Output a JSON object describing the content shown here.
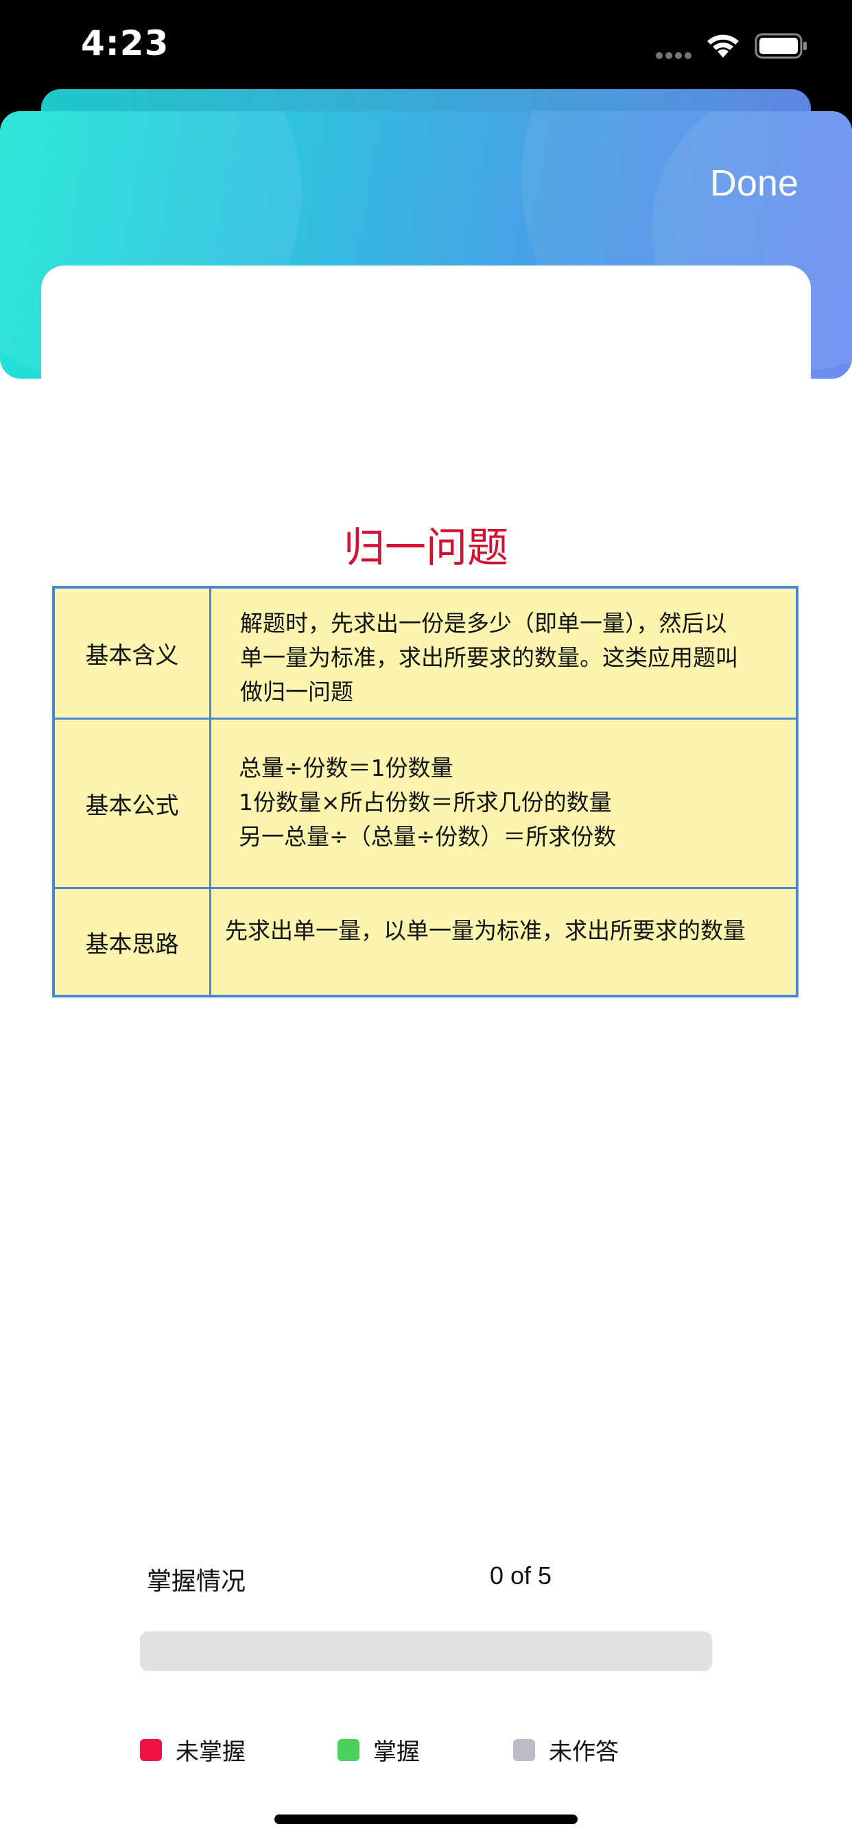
{
  "status_bar": {
    "time": "4:23"
  },
  "header": {
    "done_label": "Done"
  },
  "topic": {
    "title": "归一问题"
  },
  "table": {
    "rows": [
      {
        "label": "基本含义",
        "lines": [
          "解题时，先求出一份是多少（即单一量），然后以",
          "单一量为标准，求出所要求的数量。这类应用题叫",
          "做归一问题"
        ]
      },
      {
        "label": "基本公式",
        "lines": [
          "总量÷份数＝1份数量",
          "1份数量×所占份数＝所求几份的数量",
          "另一总量÷（总量÷份数）＝所求份数"
        ]
      },
      {
        "label": "基本思路",
        "lines": [
          "先求出单一量，以单一量为标准，求出所要求的数量"
        ]
      }
    ]
  },
  "mastery": {
    "label": "掌握情况",
    "count_text": "0 of 5",
    "progress_fraction": 0
  },
  "legend": [
    {
      "label": "未掌握",
      "color": "#ee1144"
    },
    {
      "label": "掌握",
      "color": "#4cd15c"
    },
    {
      "label": "未作答",
      "color": "#bcbcc4"
    }
  ],
  "colors": {
    "accent_title": "#d21030",
    "table_fill": "#fcf5b0",
    "table_border": "#4a86d4",
    "progress_track": "#e1e1e1"
  },
  "icons": {
    "signal": "signal-icon",
    "wifi": "wifi-icon",
    "battery": "battery-icon"
  }
}
